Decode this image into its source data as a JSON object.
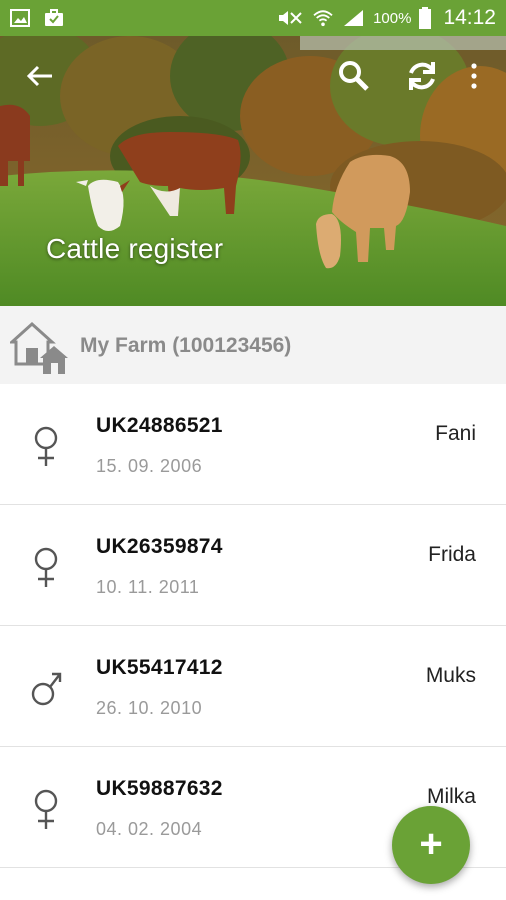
{
  "status_bar": {
    "battery_text": "100%",
    "time": "14:12",
    "color": "#6aa236",
    "icons": [
      "gallery-icon",
      "briefcase-icon",
      "mute-icon",
      "wifi-icon",
      "signal-icon",
      "battery-icon"
    ]
  },
  "header": {
    "title": "Cattle register",
    "actions": [
      "back-arrow-icon",
      "search-icon",
      "sync-icon",
      "more-vert-icon"
    ]
  },
  "farm": {
    "label": "My Farm (100123456)",
    "icon": "farm-houses-icon"
  },
  "cattle": [
    {
      "id": "UK24886521",
      "date": "15. 09. 2006",
      "name": "Fani",
      "sex": "female"
    },
    {
      "id": "UK26359874",
      "date": "10. 11. 2011",
      "name": "Frida",
      "sex": "female"
    },
    {
      "id": "UK55417412",
      "date": "26. 10. 2010",
      "name": "Muks",
      "sex": "male"
    },
    {
      "id": "UK59887632",
      "date": "04. 02. 2004",
      "name": "Milka",
      "sex": "female"
    }
  ],
  "fab": {
    "label": "+",
    "accent": "#6aa236"
  }
}
